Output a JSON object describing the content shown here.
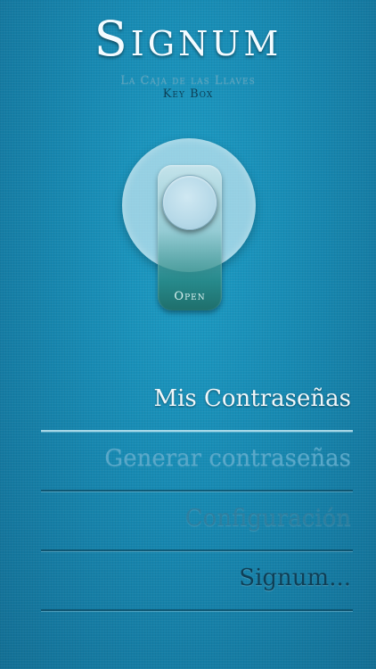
{
  "header": {
    "title": "Signum",
    "subtitle": "La Caja de las Llaves",
    "subtitle2": "Key Box"
  },
  "lock": {
    "label": "Open"
  },
  "menu": {
    "items": [
      {
        "label": "Mis Contraseñas"
      },
      {
        "label": "Generar contraseñas"
      },
      {
        "label": "Configuración"
      },
      {
        "label": "Signum..."
      }
    ]
  },
  "colors": {
    "background": "#1789b2",
    "active_item": "#f1f7fa",
    "item_2": "#5aa8c9",
    "item_3": "#2f7e9e",
    "item_4": "#0f3f56"
  }
}
